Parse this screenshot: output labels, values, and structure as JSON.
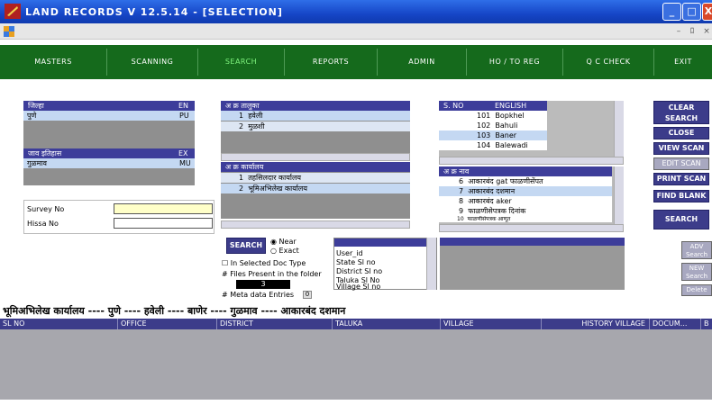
{
  "window": {
    "title": "LAND RECORDS V 12.5.14 - [SELECTION]",
    "controls": {
      "minimize": "_",
      "maximize": "□",
      "close": "X"
    },
    "mdi_controls": {
      "minimize": "–",
      "restore": "ﾛ",
      "close": "×"
    }
  },
  "nav": {
    "items": [
      "MASTERS",
      "SCANNING",
      "SEARCH",
      "REPORTS",
      "ADMIN",
      "HO / TO REG",
      "Q C CHECK",
      "EXIT"
    ],
    "active": "SEARCH"
  },
  "district_panel": {
    "header": "जिल्हा",
    "header_code": "EN",
    "value": "पुणे",
    "value_code": "PU",
    "history_header": "जाव इतिहास",
    "history_code": "EX",
    "history_value": "गुळमाव",
    "history_value_code": "MU"
  },
  "taluka_panel": {
    "header": "अ क्र  तालुका",
    "rows": [
      {
        "no": "1",
        "name": "हवेली"
      },
      {
        "no": "2",
        "name": "मुळशी"
      }
    ]
  },
  "office_panel": {
    "header": "अ क्र  कार्यालय",
    "rows": [
      {
        "no": "1",
        "name": "तहसिलदार कार्यालय"
      },
      {
        "no": "2",
        "name": "भूमिअभिलेख कार्यालय"
      }
    ]
  },
  "village_panel": {
    "col1": "S. NO",
    "col2": "ENGLISH",
    "rows": [
      {
        "no": "101",
        "name": "Bopkhel"
      },
      {
        "no": "102",
        "name": "Bahuli"
      },
      {
        "no": "103",
        "name": "Baner"
      },
      {
        "no": "104",
        "name": "Balewadi"
      }
    ]
  },
  "doc_panel": {
    "header": "अ क्र  नाव",
    "rows": [
      {
        "no": "6",
        "name": "आकारबंद gat फाळणीसेंपत"
      },
      {
        "no": "7",
        "name": "आकारबंद दशमान"
      },
      {
        "no": "8",
        "name": "आकारबंद aker"
      },
      {
        "no": "9",
        "name": "फाळणीसेपत्रक दिनांक"
      },
      {
        "no": "10",
        "name": "फाळणीसेपत्रक आणूत"
      }
    ]
  },
  "fields": {
    "survey_label": "Survey No",
    "hissa_label": "Hissa No",
    "survey_value": "",
    "hissa_value": ""
  },
  "search_box": {
    "button": "SEARCH",
    "near": "Near",
    "exact": "Exact",
    "selected_doc": "In Selected Doc Type",
    "files_present": "# Files Present in the folder",
    "files_count": "3",
    "meta_entries": "# Meta data Entries",
    "meta_value": "0"
  },
  "fields_list": {
    "items": [
      "User_id",
      "State Sl no",
      "District Sl no",
      "Taluka Sl No",
      "Village Sl no"
    ]
  },
  "side_buttons": {
    "clear": "CLEAR SEARCH",
    "close": "CLOSE",
    "view_scan": "VIEW SCAN",
    "edit_scan": "EDIT SCAN",
    "print_scan": "PRINT SCAN",
    "find_blank": "FIND BLANK",
    "search": "SEARCH",
    "adv": "ADV Search",
    "new": "NEW Search",
    "delete": "Delete"
  },
  "breadcrumb": "भूमिअभिलेख कार्यालय ---- पुणे ---- हवेली ---- बाणेर ---- गुळमाव ---- आकारबंद दशमान",
  "grid": {
    "columns": [
      "SL NO",
      "OFFICE",
      "DISTRICT",
      "TALUKA",
      "VILLAGE",
      "HISTORY VILLAGE",
      "DOCUM...",
      "B"
    ]
  },
  "colors": {
    "titlebar": "#1646c7",
    "nav": "#156a1c",
    "nav_active": "#7ef37d",
    "header": "#3d3d9a",
    "button": "#3c3c8a"
  }
}
